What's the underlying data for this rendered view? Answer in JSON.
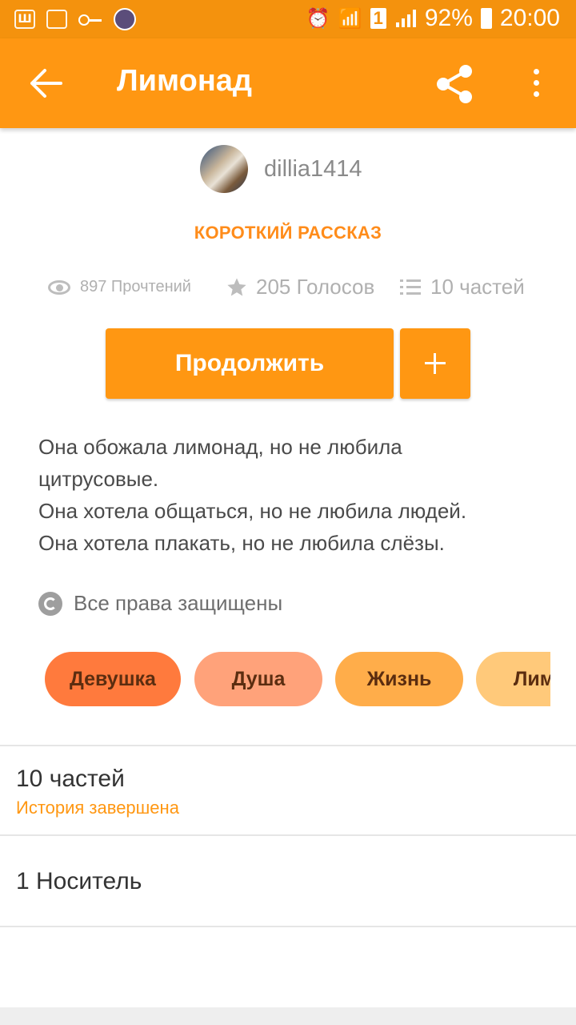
{
  "status_bar": {
    "battery": "92%",
    "time": "20:00",
    "sim_slot": "1",
    "left_icon_letter": "Ш"
  },
  "appbar": {
    "title": "Лимонад"
  },
  "author": {
    "name": "dillia1414"
  },
  "category": "КОРОТКИЙ РАССКАЗ",
  "stats": {
    "reads": "897 Прочтений",
    "votes": "205 Голосов",
    "parts": "10 частей"
  },
  "actions": {
    "continue_label": "Продолжить"
  },
  "description": [
    "Она обожала лимонад, но не любила",
    "цитрусовые.",
    "Она хотела общаться, но не любила людей.",
    "Она хотела плакать, но не любила слёзы."
  ],
  "copyright": "Все права защищены",
  "tags": [
    {
      "label": "Девушка",
      "color": "#ff7a3d"
    },
    {
      "label": "Душа",
      "color": "#ffa27a"
    },
    {
      "label": "Жизнь",
      "color": "#ffad4a"
    },
    {
      "label": "Лимо",
      "color": "#ffc97a"
    }
  ],
  "parts_section": {
    "title": "10 частей",
    "status": "История завершена"
  },
  "carrier": "1 Носитель",
  "colors": {
    "accent": "#ff9712",
    "status_bar": "#f4920d"
  }
}
